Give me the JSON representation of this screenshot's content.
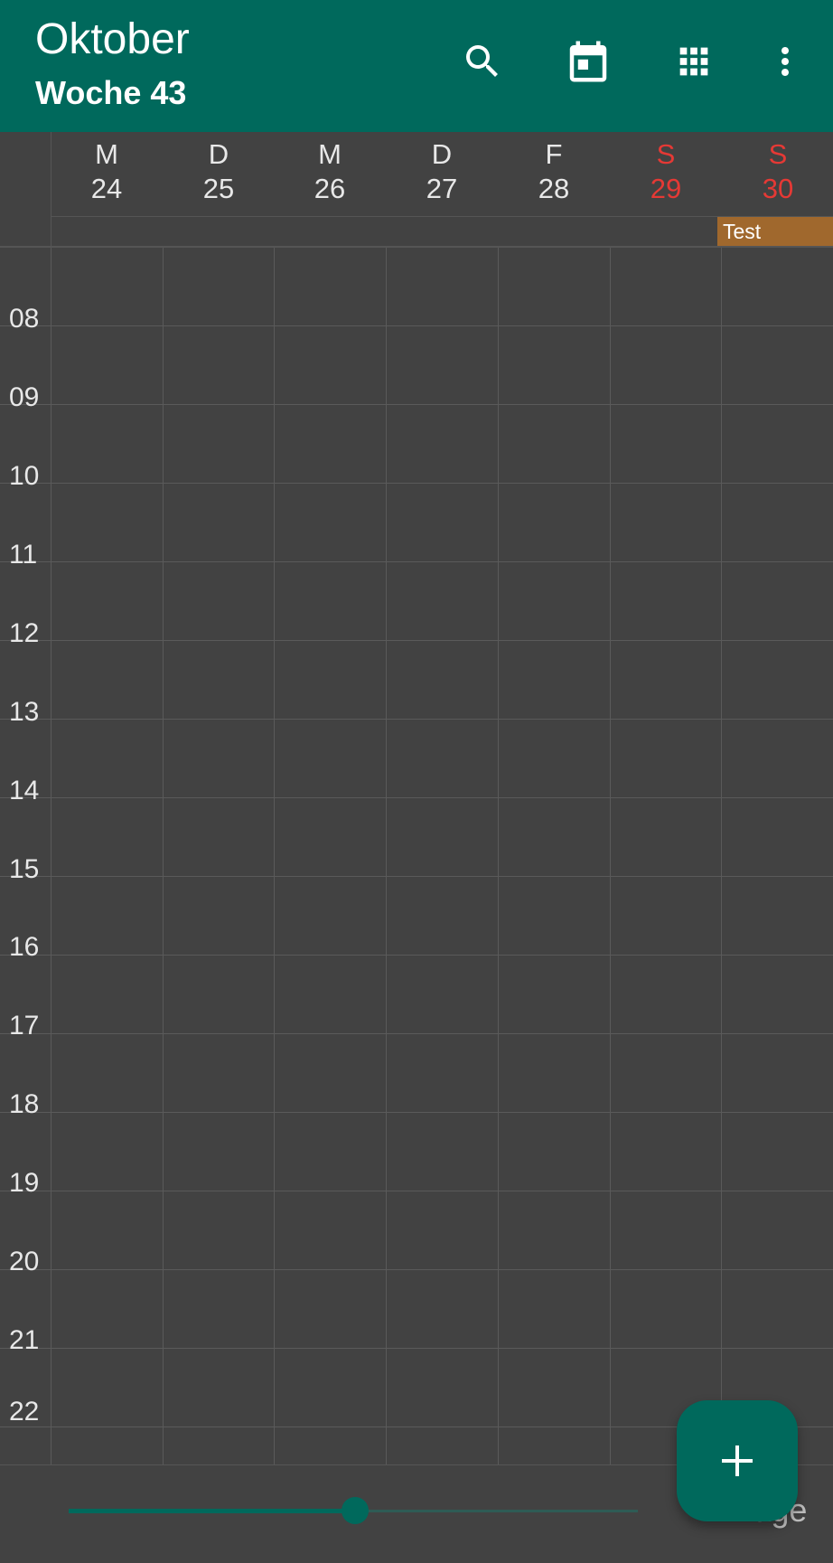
{
  "header": {
    "title": "Oktober",
    "subtitle": "Woche 43",
    "actions": [
      "search-icon",
      "calendar-today-icon",
      "grid-view-icon",
      "more-vert-icon"
    ]
  },
  "days": [
    {
      "letter": "M",
      "number": "24",
      "weekend": false
    },
    {
      "letter": "D",
      "number": "25",
      "weekend": false
    },
    {
      "letter": "M",
      "number": "26",
      "weekend": false
    },
    {
      "letter": "D",
      "number": "27",
      "weekend": false
    },
    {
      "letter": "F",
      "number": "28",
      "weekend": false
    },
    {
      "letter": "S",
      "number": "29",
      "weekend": true
    },
    {
      "letter": "S",
      "number": "30",
      "weekend": true
    }
  ],
  "all_day_events": [
    {
      "title": "Test",
      "day": "30",
      "color": "#a0682d"
    }
  ],
  "hours": [
    "08",
    "09",
    "10",
    "11",
    "12",
    "13",
    "14",
    "15",
    "16",
    "17",
    "18",
    "19",
    "20",
    "21",
    "22"
  ],
  "footer": {
    "days_label": "7 Tage",
    "slider_fraction": 0.5
  },
  "fab": {
    "icon": "plus-icon"
  },
  "colors": {
    "accent": "#00695c",
    "weekend": "#e53935",
    "background": "#424242"
  }
}
